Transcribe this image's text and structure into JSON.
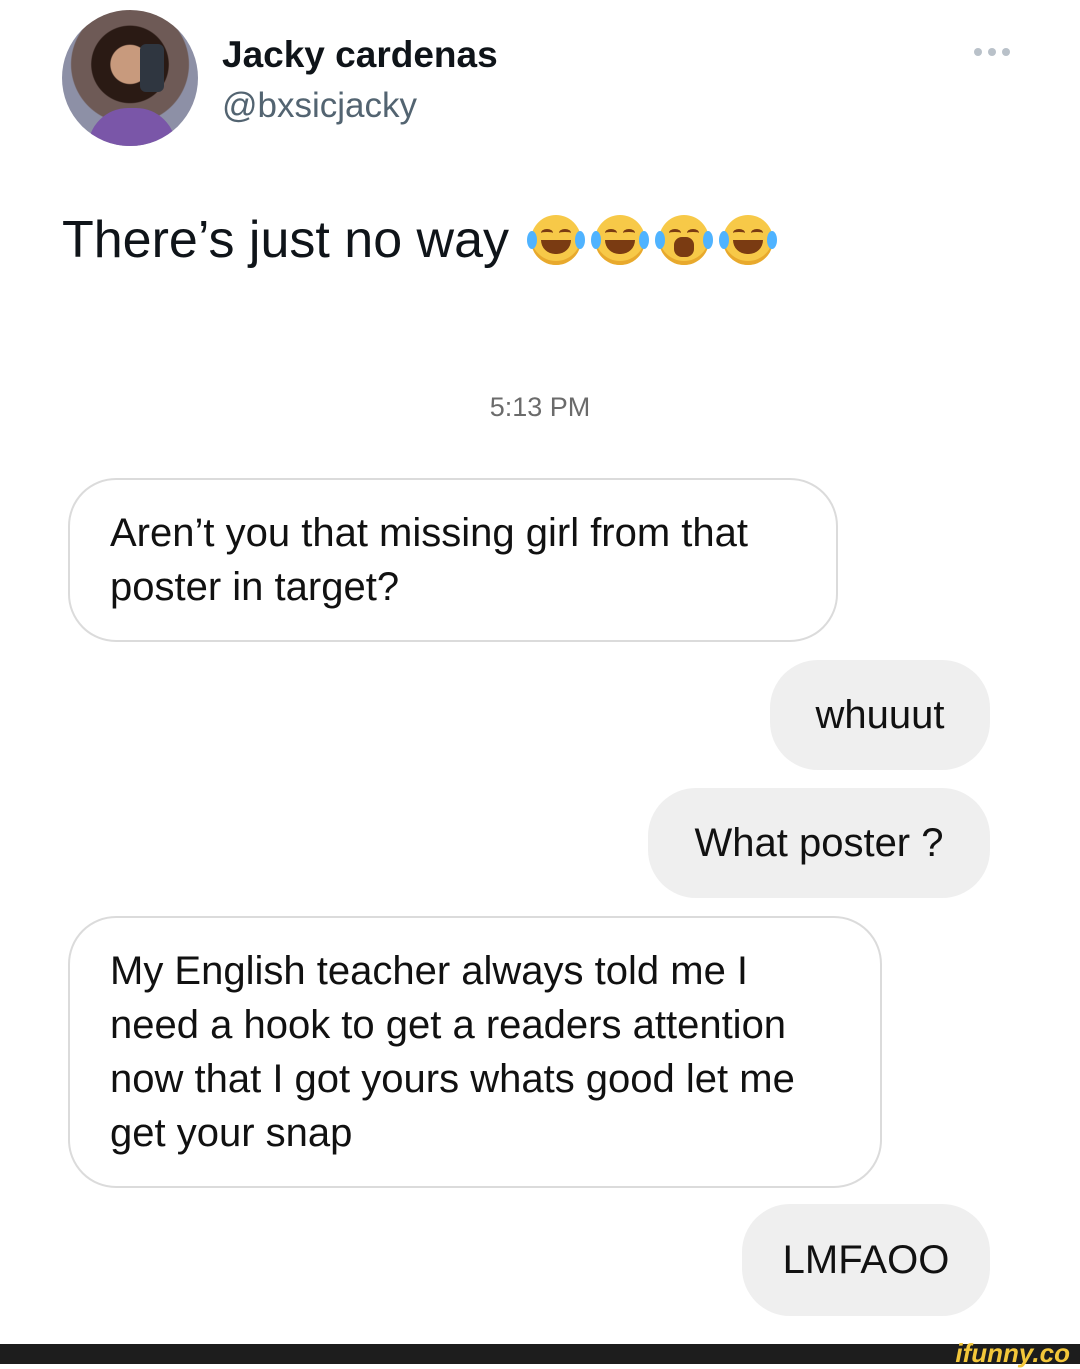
{
  "author": {
    "name": "Jacky cardenas",
    "handle": "@bxsicjacky"
  },
  "tweet": {
    "text": "There’s just no way",
    "emojis": [
      "face-with-tears-of-joy-icon",
      "face-with-tears-of-joy-icon",
      "loudly-crying-face-icon",
      "face-with-tears-of-joy-icon"
    ]
  },
  "chat": {
    "timestamp": "5:13 PM",
    "messages": [
      {
        "side": "received",
        "text": "Aren’t you that missing girl from that poster in target?"
      },
      {
        "side": "sent",
        "text": "whuuut"
      },
      {
        "side": "sent",
        "text": "What poster ?"
      },
      {
        "side": "received",
        "text": "My English teacher always told me I need a hook to get a readers attention now that I got yours whats good let me get your snap"
      },
      {
        "side": "sent",
        "text": "LMFAOO"
      }
    ]
  },
  "watermark": {
    "text": "ifunny.co"
  },
  "colors": {
    "sent_bubble": "#efefef",
    "received_border": "#dbdbdb",
    "handle": "#536471"
  }
}
